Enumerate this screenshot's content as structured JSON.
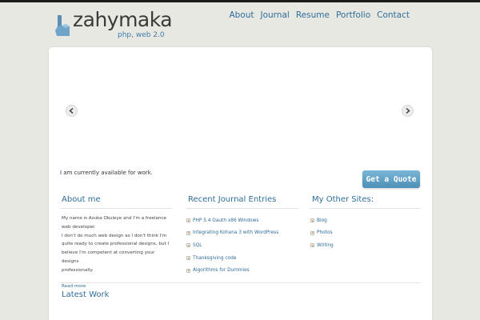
{
  "site": {
    "logo_text": "zahymaka",
    "tagline": "php, web 2.0"
  },
  "nav": {
    "items": [
      "About",
      "Journal",
      "Resume",
      "Portfolio",
      "Contact"
    ]
  },
  "slider": {
    "prev_icon": "chevron-left-icon",
    "next_icon": "chevron-right-icon"
  },
  "availability": {
    "text": "I am currently available for work.",
    "button_label": "Get a Quote"
  },
  "about": {
    "heading": "About me",
    "lines": [
      "My name is Azuka Okuleye and I'm a freelance",
      "web developer.",
      "I don't do much web design as I don't think I'm",
      "quite ready to create professional designs, but I",
      "believe I'm competent at converting your designs",
      "professionally."
    ],
    "read_more": "Read more"
  },
  "journal": {
    "heading": "Recent Journal Entries",
    "entries": [
      "PHP 5.4 Oauth x86 Windows",
      "Integrating Kohana 3 with WordPress",
      "SQL",
      "Thanksgiving code",
      "Algorithms for Dummies"
    ]
  },
  "other_sites": {
    "heading": "My Other Sites:",
    "items": [
      "Blog",
      "Photos",
      "Writing"
    ]
  },
  "latest_work": {
    "heading": "Latest Work"
  },
  "colors": {
    "accent": "#2f6d99",
    "button": "#5a9bc3",
    "background": "#e8e8e3",
    "bullet": "#d47a2a"
  }
}
